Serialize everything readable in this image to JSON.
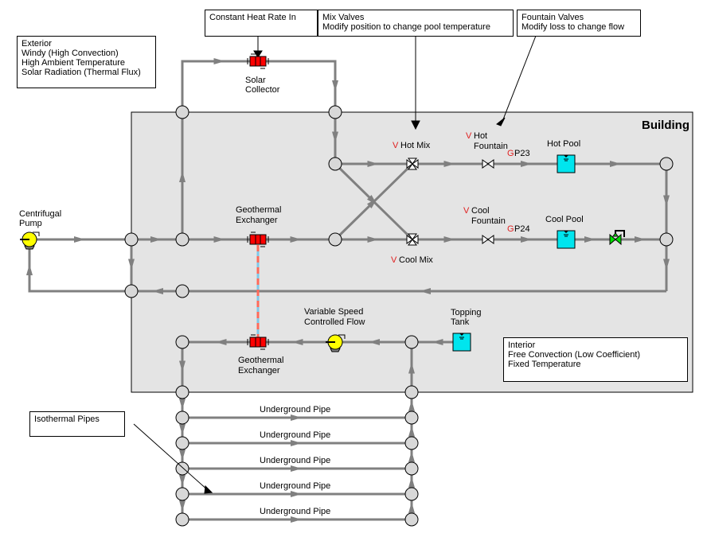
{
  "building": {
    "title": "Building",
    "background": "#e4e4e4"
  },
  "notes": {
    "exterior": [
      "Exterior",
      "Windy (High Convection)",
      "High Ambient Temperature",
      "Solar Radiation (Thermal Flux)"
    ],
    "constant_heat": [
      "Constant Heat Rate In"
    ],
    "mix_valves": [
      "Mix Valves",
      "Modify position to change pool temperature"
    ],
    "fountain_valves": [
      "Fountain Valves",
      "Modify loss to change flow"
    ],
    "interior": [
      "Interior",
      "Free Convection (Low Coefficient)",
      "Fixed Temperature"
    ],
    "isothermal": [
      "Isothermal Pipes"
    ]
  },
  "components": {
    "solar_collector": [
      "Solar",
      "Collector"
    ],
    "centrifugal_pump": [
      "Centrifugal",
      "Pump"
    ],
    "geo_exchanger_top": [
      "Geothermal",
      "Exchanger"
    ],
    "geo_exchanger_bottom": [
      "Geothermal",
      "Exchanger"
    ],
    "vs_pump": [
      "Variable Speed",
      "Controlled Flow"
    ],
    "topping_tank": [
      "Topping",
      "Tank"
    ],
    "hot_mix": {
      "flag": "V",
      "label": "Hot Mix"
    },
    "cool_mix": {
      "flag": "V",
      "label": "Cool Mix"
    },
    "hot_fountain": {
      "flag": "V",
      "lines": [
        "Hot",
        "Fountain"
      ],
      "pipe_flag": "G",
      "pipe": "P23"
    },
    "cool_fountain": {
      "flag": "V",
      "lines": [
        "Cool",
        "Fountain"
      ],
      "pipe_flag": "G",
      "pipe": "P24"
    },
    "hot_pool": "Hot Pool",
    "cool_pool": "Cool Pool"
  },
  "underground_pipes": [
    "Underground Pipe",
    "Underground Pipe",
    "Underground Pipe",
    "Underground Pipe",
    "Underground Pipe"
  ],
  "colors": {
    "pipe": "#808080",
    "junction": "#d8d8d8",
    "exchanger": "#ff0000",
    "pump": "#ffff00",
    "tank": "#00e5ee",
    "control_valve": "#00e000",
    "thermal_link_a": "#ff6a5a",
    "thermal_link_b": "#7fc8e8"
  }
}
